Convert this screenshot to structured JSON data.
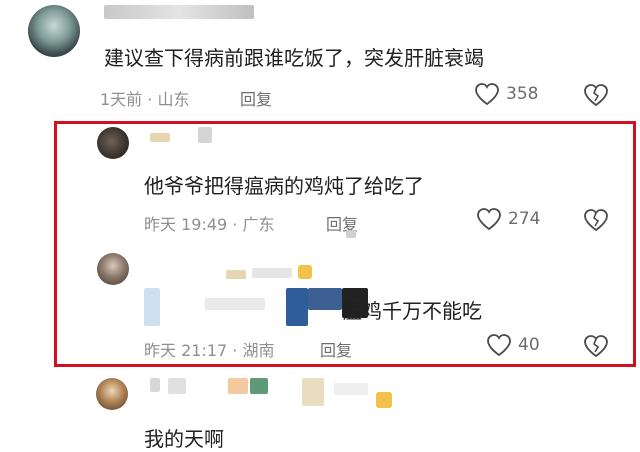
{
  "comments": [
    {
      "text": "建议查下得病前跟谁吃饭了，突发肝脏衰竭",
      "meta": "1天前 · 山东",
      "reply_label": "回复",
      "likes": "358"
    },
    {
      "text": "他爷爷把得瘟病的鸡炖了给吃了",
      "meta": "昨天 19:49 · 广东",
      "reply_label": "回复",
      "likes": "274"
    },
    {
      "text": "瘟鸡千万不能吃",
      "meta": "昨天 21:17 · 湖南",
      "reply_label": "回复",
      "likes": "40"
    },
    {
      "text": "我的天啊"
    }
  ],
  "colors": {
    "highlight_border": "#d10f1f",
    "meta_text": "#8f8f8f"
  },
  "icons": {
    "like": "heart-outline-icon",
    "dislike": "broken-heart-icon"
  }
}
